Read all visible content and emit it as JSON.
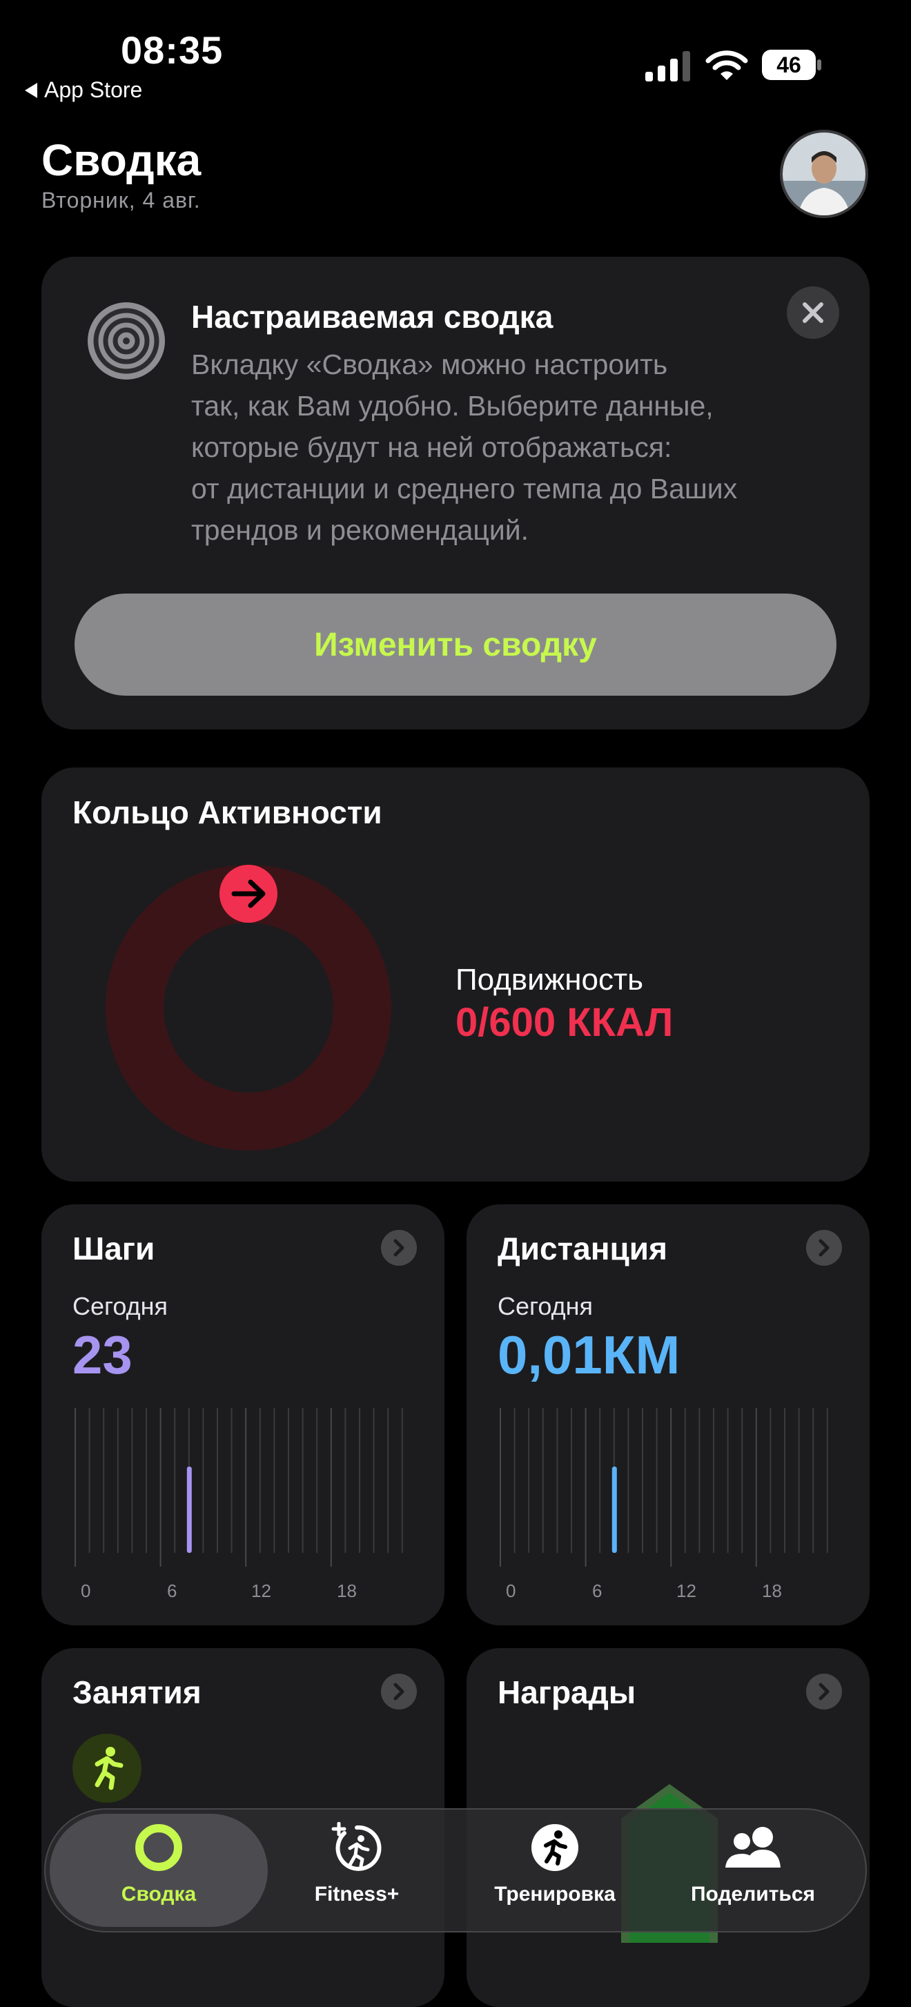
{
  "status_bar": {
    "time": "08:35",
    "back_label": "App Store",
    "battery": "46"
  },
  "header": {
    "title": "Сводка",
    "subtitle": "Вторник, 4 авг."
  },
  "promo": {
    "title": "Настраиваемая сводка",
    "body": "Вкладку «Сводка» можно настроить\nтак, как Вам удобно. Выберите данные,\nкоторые будут на ней отображаться:\nот дистанции и среднего темпа до Ваших\nтрендов и рекомендаций.",
    "button_label": "Изменить сводку"
  },
  "activity": {
    "title": "Кольцо Активности",
    "move_label": "Подвижность",
    "move_value": "0/600 ККАЛ",
    "move_progress": 0,
    "colors": {
      "move": "#f1304f",
      "move_track": "#3b1418"
    }
  },
  "steps": {
    "title": "Шаги",
    "today_label": "Сегодня",
    "value": "23",
    "color": "#a694f0",
    "axis_labels": [
      "0",
      "6",
      "12",
      "18"
    ],
    "chart_data": {
      "type": "bar",
      "hours": 24,
      "active_hour": 8
    }
  },
  "distance": {
    "title": "Дистанция",
    "today_label": "Сегодня",
    "value": "0,01КМ",
    "color": "#5ab4f8",
    "axis_labels": [
      "0",
      "6",
      "12",
      "18"
    ],
    "chart_data": {
      "type": "bar",
      "hours": 24,
      "active_hour": 8
    }
  },
  "workouts": {
    "title": "Занятия"
  },
  "awards": {
    "title": "Награды"
  },
  "tabs": [
    {
      "label": "Сводка",
      "icon": "activity-ring-icon",
      "active": true
    },
    {
      "label": "Fitness+",
      "icon": "fitness-plus-icon",
      "active": false
    },
    {
      "label": "Тренировка",
      "icon": "running-figure-icon",
      "active": false
    },
    {
      "label": "Поделиться",
      "icon": "people-icon",
      "active": false
    }
  ],
  "colors": {
    "accent": "#c6f84d",
    "background": "#000000",
    "card": "#1c1c1e"
  }
}
